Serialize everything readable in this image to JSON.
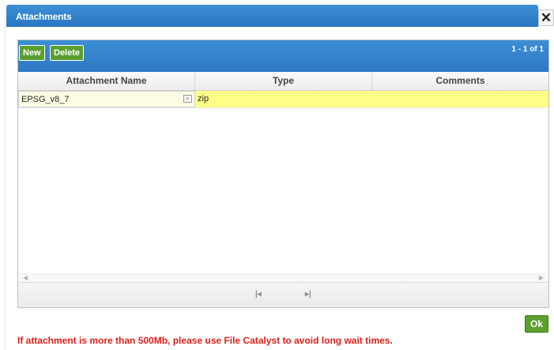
{
  "dialog": {
    "title": "Attachments",
    "close_icon": "close-icon"
  },
  "toolbar": {
    "new_label": "New",
    "delete_label": "Delete",
    "record_count": "1 - 1 of 1"
  },
  "grid": {
    "columns": [
      "Attachment Name",
      "Type",
      "Comments"
    ],
    "rows": [
      {
        "name": "EPSG_v8_7",
        "type": "zip",
        "comments": "",
        "lookup_icon": "magnifier-icon"
      }
    ]
  },
  "pager": {
    "first_icon": "first-page-icon",
    "last_icon": "last-page-icon"
  },
  "footer": {
    "ok_label": "Ok",
    "notice": "If attachment is more than 500Mb, please use File Catalyst to avoid long wait times."
  },
  "colors": {
    "header_blue": "#2e79c2",
    "button_green": "#5c9e30",
    "row_highlight": "#ffff87",
    "notice_red": "#e0201b"
  }
}
